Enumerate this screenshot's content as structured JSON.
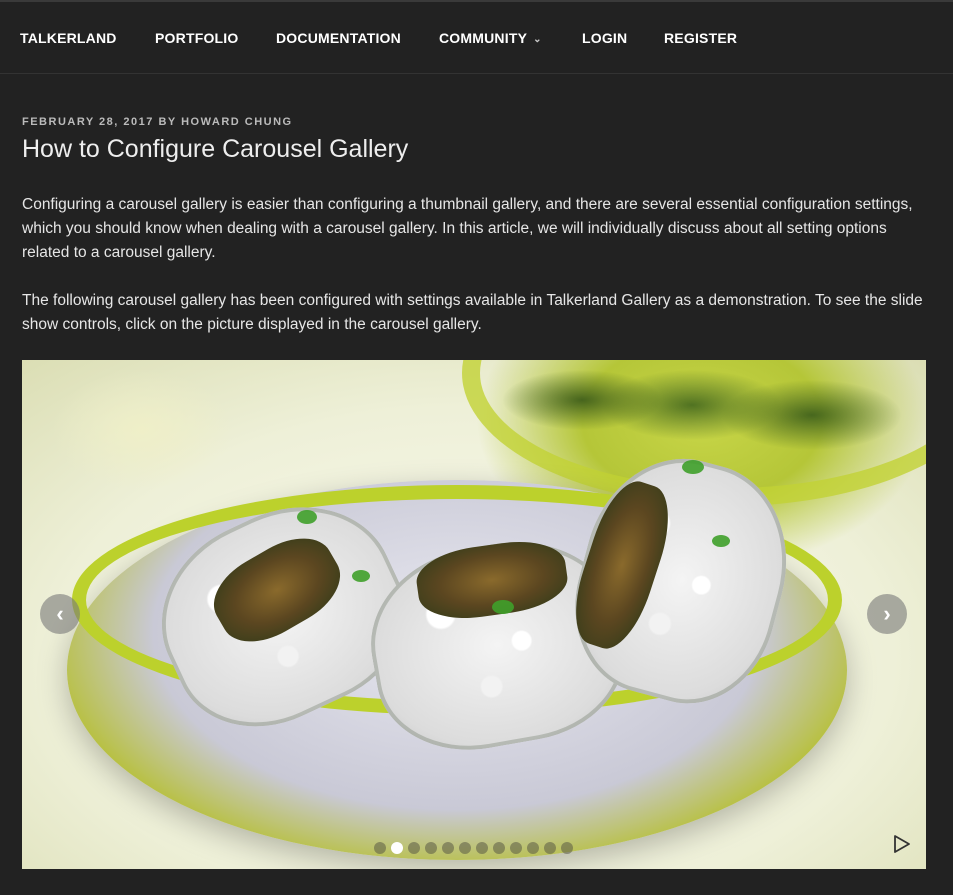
{
  "nav": {
    "items": [
      {
        "label": "TALKERLAND"
      },
      {
        "label": "PORTFOLIO"
      },
      {
        "label": "DOCUMENTATION"
      },
      {
        "label": "COMMUNITY"
      },
      {
        "label": "LOGIN"
      },
      {
        "label": "REGISTER"
      }
    ],
    "dropdown_icon": "chevron-down-icon"
  },
  "post": {
    "date": "FEBRUARY 28, 2017",
    "by": "BY",
    "author": "HOWARD CHUNG",
    "title": "How to Configure Carousel Gallery",
    "paragraphs": [
      "Configuring a carousel gallery is easier than configuring a thumbnail gallery, and there are several essential configuration settings, which you should know when dealing with a carousel gallery.  In this article, we will individually discuss about all setting options related to a carousel gallery.",
      "The following carousel gallery has been configured with settings available in Talkerland Gallery as a demonstration. To see the slide show controls, click on the picture displayed in the carousel gallery."
    ]
  },
  "carousel": {
    "image_subject": "sushi rolls in a green bowl",
    "prev_icon": "chevron-left-icon",
    "next_icon": "chevron-right-icon",
    "play_icon": "play-icon",
    "slide_count": 12,
    "active_slide_index": 1
  },
  "colors": {
    "background": "#222222",
    "text": "#e6e6e6",
    "accent_bowl": "#bcd12c"
  }
}
